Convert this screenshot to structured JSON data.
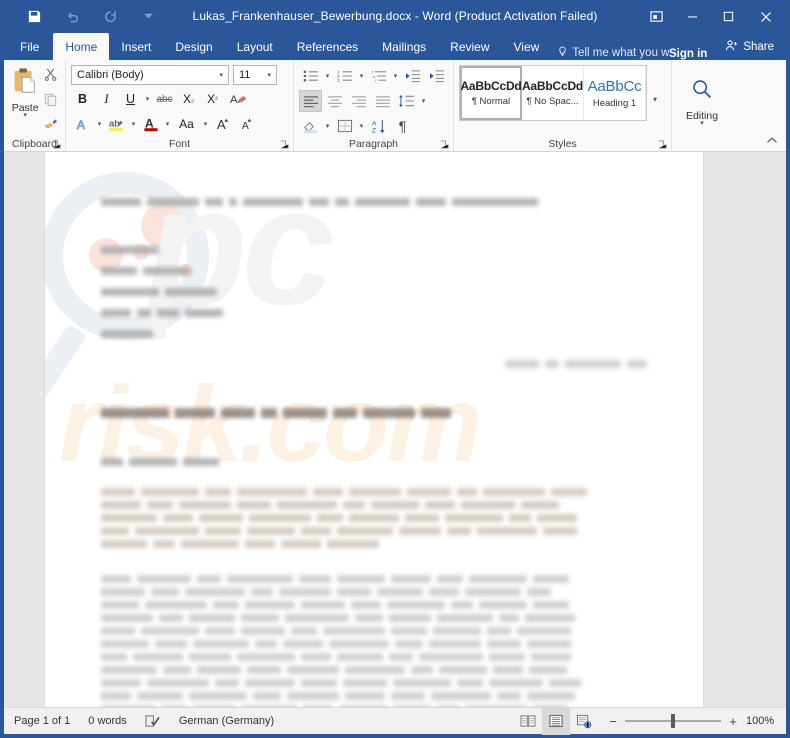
{
  "window": {
    "title": "Lukas_Frankenhauser_Bewerbung.docx - Word (Product Activation Failed)",
    "accent_color": "#2b579a",
    "controls": {
      "ribbon_display_options": "ribbon-display-options",
      "minimize": "Minimize",
      "maximize": "Maximize",
      "close": "Close"
    }
  },
  "quick_access": {
    "items": [
      {
        "name": "save",
        "icon": "save-icon",
        "enabled": true
      },
      {
        "name": "undo",
        "icon": "undo-icon",
        "enabled": false
      },
      {
        "name": "redo",
        "icon": "redo-icon",
        "enabled": false
      },
      {
        "name": "customize",
        "icon": "chevron-down-icon",
        "enabled": true
      }
    ]
  },
  "tabs": {
    "items": [
      {
        "label": "File",
        "active": false
      },
      {
        "label": "Home",
        "active": true
      },
      {
        "label": "Insert",
        "active": false
      },
      {
        "label": "Design",
        "active": false
      },
      {
        "label": "Layout",
        "active": false
      },
      {
        "label": "References",
        "active": false
      },
      {
        "label": "Mailings",
        "active": false
      },
      {
        "label": "Review",
        "active": false
      },
      {
        "label": "View",
        "active": false
      }
    ],
    "tell_me": "Tell me what you war",
    "sign_in": "Sign in",
    "share": "Share"
  },
  "ribbon": {
    "groups": [
      {
        "label": "Clipboard"
      },
      {
        "label": "Font"
      },
      {
        "label": "Paragraph"
      },
      {
        "label": "Styles"
      }
    ],
    "clipboard": {
      "paste_label": "Paste",
      "cut": "Cut",
      "copy": "Copy",
      "format_painter": "Format Painter"
    },
    "font": {
      "font_name": "Calibri (Body)",
      "font_size": "11",
      "bold": "B",
      "italic": "I",
      "underline": "U",
      "strikethrough": "abc",
      "subscript": "X₂",
      "superscript": "X²",
      "clear_formatting": "Clear Formatting",
      "text_effects": "A",
      "highlight": "ab",
      "font_color": "A",
      "change_case": "Aa",
      "grow_font": "A",
      "shrink_font": "A"
    },
    "paragraph": {
      "bullets": "Bullets",
      "numbering": "Numbering",
      "multilevel": "Multilevel List",
      "decrease_indent": "Decrease Indent",
      "increase_indent": "Increase Indent",
      "align_left": "Align Left",
      "align_center": "Center",
      "align_right": "Align Right",
      "justify": "Justify",
      "line_spacing": "Line and Paragraph Spacing",
      "shading": "Shading",
      "borders": "Borders",
      "sort": "Sort",
      "show_marks": "¶"
    },
    "styles": {
      "items": [
        {
          "preview": "AaBbCcDd",
          "name": "¶ Normal",
          "selected": true,
          "kind": "normal"
        },
        {
          "preview": "AaBbCcDd",
          "name": "¶ No Spac...",
          "selected": false,
          "kind": "normal"
        },
        {
          "preview": "AaBbCc",
          "name": "Heading 1",
          "selected": false,
          "kind": "heading"
        }
      ],
      "more": "More Styles"
    },
    "editing": {
      "label": "Editing",
      "icon": "search-icon"
    },
    "collapse": "Collapse the Ribbon"
  },
  "document": {
    "watermark": {
      "primary_text": "pc",
      "secondary_text": "risk.com",
      "logo": "magnifier-logo"
    },
    "redacted_note": "Document body text is blurred / redacted in the screenshot",
    "blocks": [
      {
        "type": "header-line",
        "widths": [
          40,
          52,
          18,
          8,
          60,
          20,
          14,
          55,
          30,
          86
        ],
        "tone": "dark"
      },
      {
        "type": "gap",
        "size": "lg"
      },
      {
        "type": "line",
        "widths": [
          58
        ],
        "tone": "dark"
      },
      {
        "type": "gap",
        "size": "sm"
      },
      {
        "type": "line",
        "widths": [
          36,
          48
        ],
        "tone": "dark"
      },
      {
        "type": "gap",
        "size": "sm"
      },
      {
        "type": "line",
        "widths": [
          58,
          52
        ],
        "tone": "dark"
      },
      {
        "type": "gap",
        "size": "sm"
      },
      {
        "type": "line",
        "widths": [
          30,
          14,
          22,
          38
        ],
        "tone": "dark"
      },
      {
        "type": "gap",
        "size": "sm"
      },
      {
        "type": "line",
        "widths": [
          52
        ],
        "tone": "dark"
      },
      {
        "type": "gap",
        "size": "md"
      },
      {
        "type": "date-line",
        "widths": [
          34,
          14,
          56,
          20
        ],
        "tone": "light",
        "align": "right"
      },
      {
        "type": "gap",
        "size": "lg"
      },
      {
        "type": "subject",
        "widths": [
          68,
          40,
          34,
          16,
          44,
          24,
          52,
          30
        ],
        "tone": "title"
      },
      {
        "type": "gap",
        "size": "lg"
      },
      {
        "type": "salutation",
        "widths": [
          22,
          48,
          36
        ],
        "tone": "dark"
      },
      {
        "type": "gap",
        "size": "md"
      },
      {
        "type": "paragraph",
        "tone": "warm",
        "lines": [
          [
            34,
            58,
            26,
            70,
            30,
            52,
            44,
            20,
            62,
            36
          ],
          [
            40,
            26,
            52,
            34,
            60,
            22,
            48,
            30,
            54,
            38
          ],
          [
            56,
            30,
            44,
            62,
            26,
            50,
            34,
            58,
            22,
            40
          ],
          [
            28,
            64,
            36,
            48,
            30,
            56,
            42,
            24,
            60,
            34
          ],
          [
            46,
            22,
            58,
            30,
            40,
            52
          ]
        ]
      },
      {
        "type": "gap",
        "size": "md"
      },
      {
        "type": "paragraph",
        "tone": "light",
        "lines": [
          [
            30,
            54,
            24,
            66,
            32,
            48,
            40,
            26,
            58,
            36
          ],
          [
            44,
            28,
            60,
            22,
            52,
            34,
            46,
            30,
            56,
            24
          ],
          [
            38,
            62,
            26,
            50,
            44,
            30,
            58,
            22,
            48,
            36
          ],
          [
            52,
            24,
            46,
            38,
            64,
            28,
            42,
            56,
            20,
            50
          ],
          [
            34,
            58,
            30,
            44,
            26,
            62,
            36,
            48,
            24,
            54
          ],
          [
            48,
            32,
            56,
            22,
            40,
            60,
            28,
            52,
            34,
            44
          ],
          [
            26,
            50,
            42,
            58,
            30,
            46,
            24,
            64,
            36,
            40
          ],
          [
            56,
            28,
            44,
            34,
            52,
            60,
            22,
            48,
            30,
            38
          ],
          [
            40,
            62,
            24,
            50,
            36,
            44,
            58,
            26,
            54,
            32
          ],
          [
            30,
            46,
            58,
            28,
            52,
            40,
            34,
            60,
            24,
            48
          ],
          [
            54,
            26,
            42,
            56,
            30,
            48,
            38,
            22,
            62,
            34
          ],
          [
            44,
            36,
            52,
            24,
            58,
            30,
            46,
            40,
            28,
            56
          ]
        ]
      }
    ]
  },
  "status_bar": {
    "page": "Page 1 of 1",
    "words": "0 words",
    "proofing_icon": "proofing-errors-icon",
    "language": "German (Germany)",
    "views": [
      {
        "name": "read-mode",
        "icon": "read-mode-icon",
        "active": false
      },
      {
        "name": "print-layout",
        "icon": "print-layout-icon",
        "active": true
      },
      {
        "name": "web-layout",
        "icon": "web-layout-icon",
        "active": false
      }
    ],
    "zoom_out": "−",
    "zoom_in": "+",
    "zoom_level": "100%"
  }
}
